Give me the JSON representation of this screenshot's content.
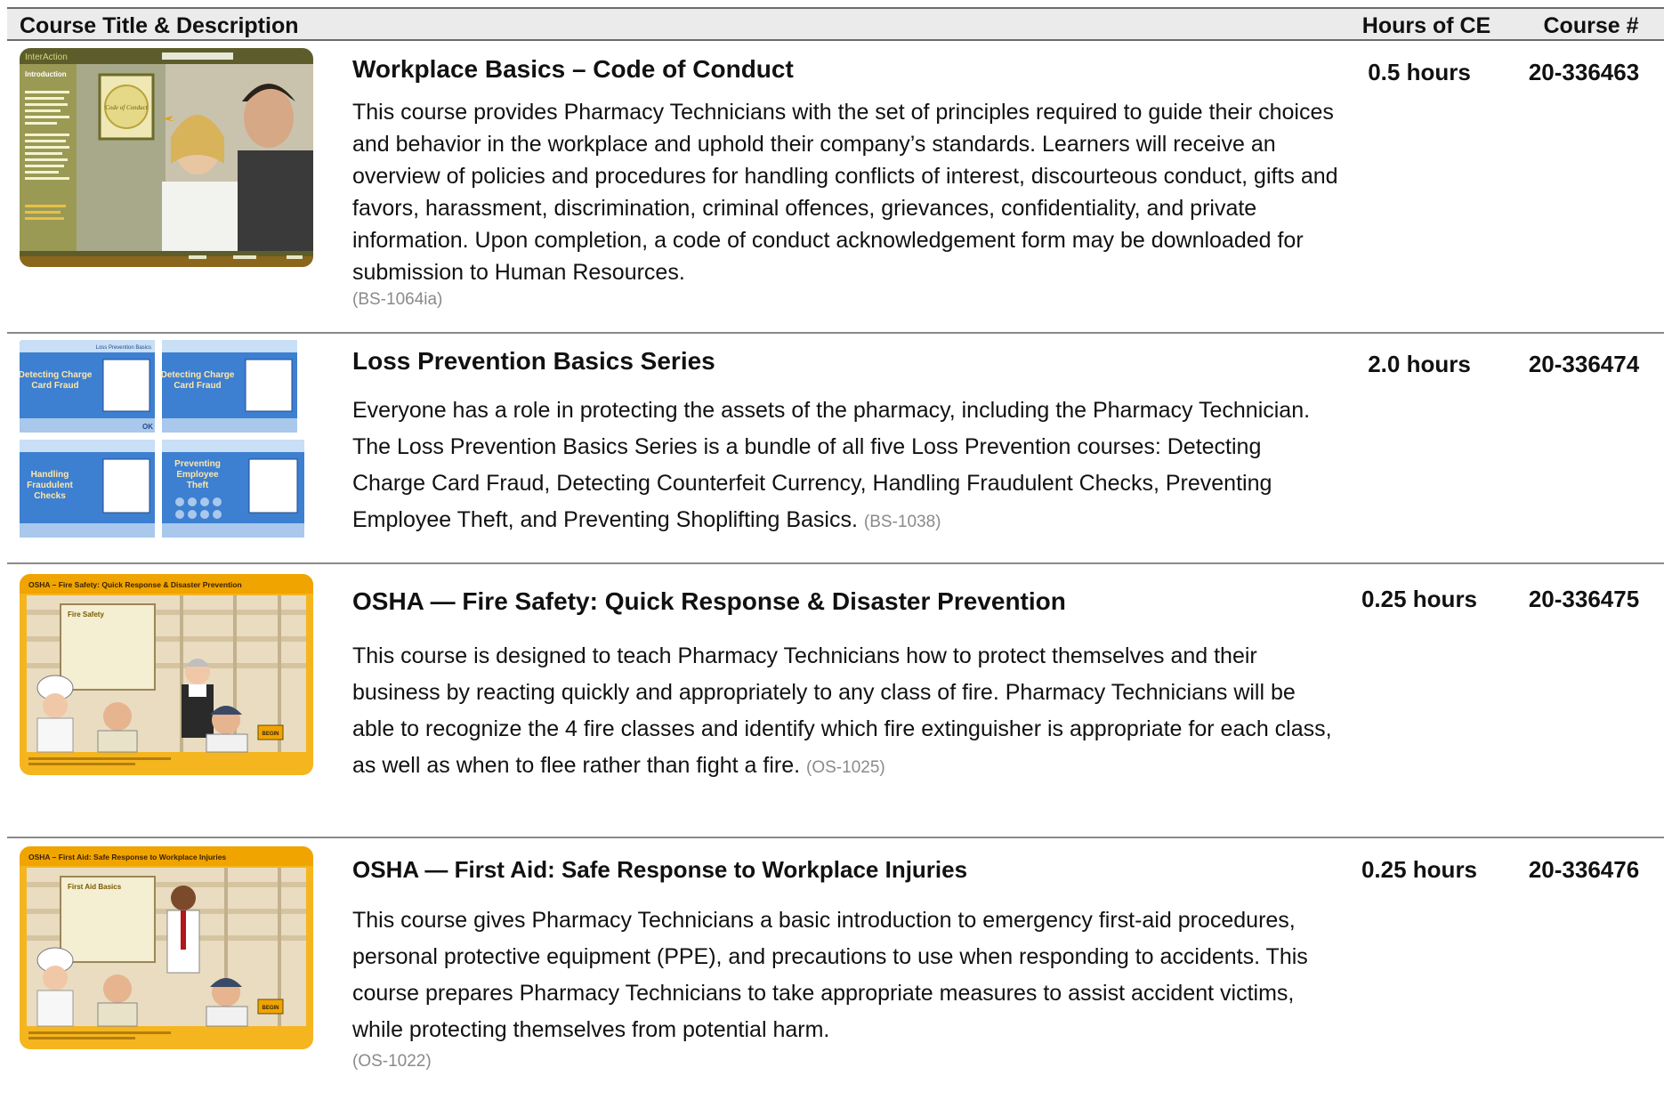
{
  "header": {
    "title_col": "Course Title & Description",
    "hours_col": "Hours of CE",
    "number_col": "Course #"
  },
  "courses": [
    {
      "title": "Workplace Basics – Code of Conduct",
      "description": "This course provides Pharmacy Technicians with the set of principles required to guide their choices and behavior in the workplace and uphold their company’s standards. Learners will receive an overview of policies and procedures for handling conflicts of interest, discourteous conduct, gifts and favors, harassment, discrimination, criminal offences, grievances, confidentiality, and private information. Upon completion, a code of conduct acknowledgement form may be downloaded for submission to Human Resources.",
      "code": "(BS-1064ia)",
      "hours": "0.5 hours",
      "number": "20-336463"
    },
    {
      "title": "Loss Prevention Basics Series",
      "description": "Everyone has a role in protecting the assets of the pharmacy, including the Pharmacy Technician. The Loss Prevention Basics Series is a bundle of all five Loss Prevention courses: Detecting Charge Card Fraud, Detecting Counterfeit Currency, Handling Fraudulent Checks, Preventing Employee Theft, and Preventing Shoplifting Basics.",
      "code": "(BS-1038)",
      "hours": "2.0 hours",
      "number": "20-336474"
    },
    {
      "title": "OSHA — Fire Safety: Quick Response & Disaster Prevention",
      "description": "This course is designed to teach Pharmacy Technicians how to protect themselves and their business by reacting quickly and appropriately to any class of fire. Pharmacy Technicians will be able to recognize the 4 fire classes and identify which fire extinguisher is appropriate for each class, as well as when to flee rather than fight a fire.",
      "code": "(OS-1025)",
      "hours": "0.25 hours",
      "number": "20-336475"
    },
    {
      "title": "OSHA — First Aid: Safe Response to Workplace Injuries",
      "description": "This course gives Pharmacy Technicians a basic introduction to emergency first-aid procedures, personal protective equipment (PPE), and precautions to use when responding to accidents. This course prepares Pharmacy Technicians to take appropriate measures to assist accident victims, while protecting themselves from potential harm.",
      "code": "(OS-1022)",
      "hours": "0.25 hours",
      "number": "20-336476"
    }
  ],
  "thumbnails": {
    "conduct": {
      "brand": "InterAction",
      "heading": "Introduction",
      "badge": "Code of Conduct"
    },
    "loss": {
      "banner": "Loss Prevention Basics",
      "tiles": [
        "Detecting Charge Card Fraud",
        "Detecting Charge Card Fraud",
        "Handling Fraudulent Checks",
        "Preventing Employee Theft"
      ],
      "ok": "OK"
    },
    "fire": {
      "banner": "OSHA – Fire Safety: Quick Response & Disaster Prevention",
      "board": "Fire Safety",
      "begin": "BEGIN"
    },
    "firstaid": {
      "banner": "OSHA – First Aid: Safe Response to Workplace Injuries",
      "board": "First Aid Basics",
      "begin": "BEGIN"
    }
  },
  "colors": {
    "header_bg": "#ebebeb",
    "rule": "#8a8a8a",
    "osha_yellow": "#f5b51f",
    "loss_blue": "#3d7fd1",
    "conduct_olive": "#7a7a3c"
  }
}
